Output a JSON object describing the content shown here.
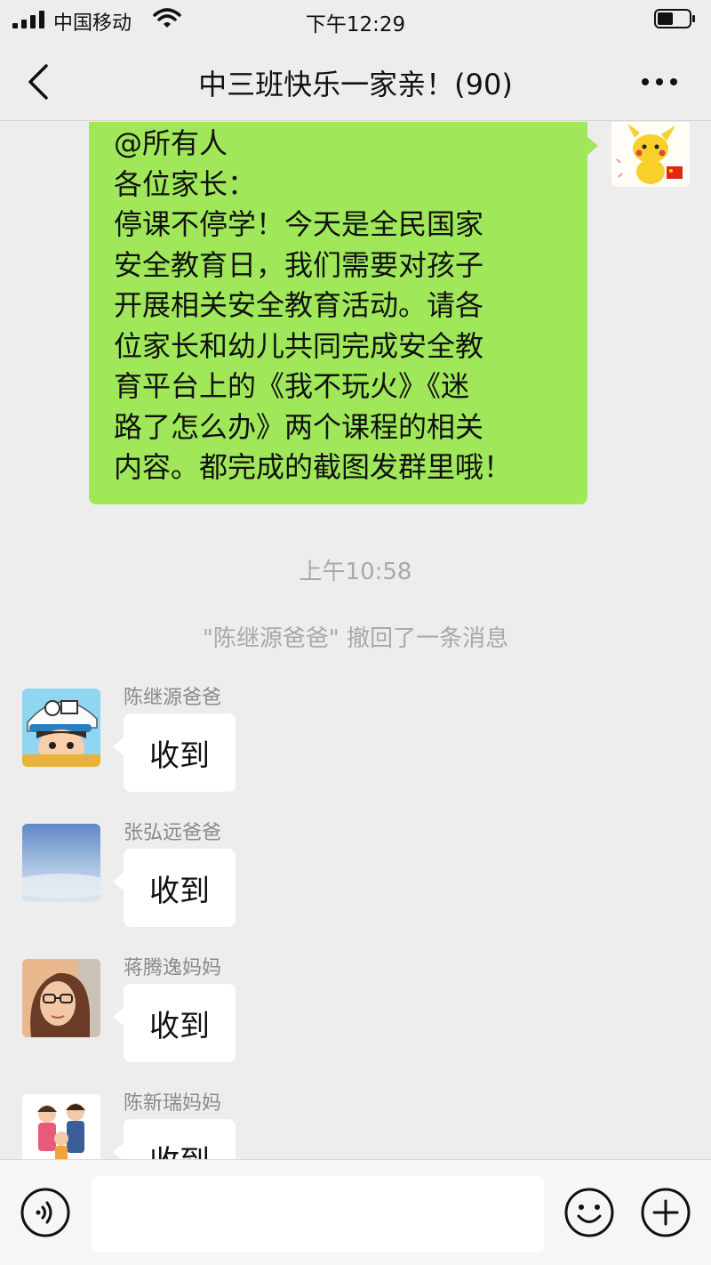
{
  "status_bar": {
    "carrier": "中国移动",
    "time": "下午12:29",
    "signal_icon": "signal-bars-icon",
    "wifi_icon": "wifi-icon",
    "battery_icon": "battery-icon"
  },
  "nav": {
    "title": "中三班快乐一家亲！(90)",
    "back_icon": "chevron-left-icon",
    "more_icon": "ellipsis-icon"
  },
  "my_message": {
    "text": "@所有人\n各位家长：\n停课不停学！今天是全民国家\n安全教育日，我们需要对孩子\n开展相关安全教育活动。请各\n位家长和幼儿共同完成安全教\n育平台上的《我不玩火》《迷\n路了怎么办》两个课程的相关\n内容。都完成的截图发群里哦！",
    "bubble_color": "#a0e75a"
  },
  "time_label": "上午10:58",
  "system_message": "\"陈继源爸爸\" 撤回了一条消息",
  "messages": [
    {
      "sender": "陈继源爸爸",
      "text": "收到"
    },
    {
      "sender": "张弘远爸爸",
      "text": "收到"
    },
    {
      "sender": "蒋腾逸妈妈",
      "text": "收到"
    },
    {
      "sender": "陈新瑞妈妈",
      "text": "收到"
    }
  ],
  "input_bar": {
    "voice_icon": "voice-icon",
    "emoji_icon": "emoji-icon",
    "plus_icon": "plus-icon",
    "input_value": ""
  },
  "colors": {
    "background": "#ededed",
    "self_bubble": "#a0e75a",
    "other_bubble": "#ffffff",
    "meta_text": "#a9a9a9"
  }
}
